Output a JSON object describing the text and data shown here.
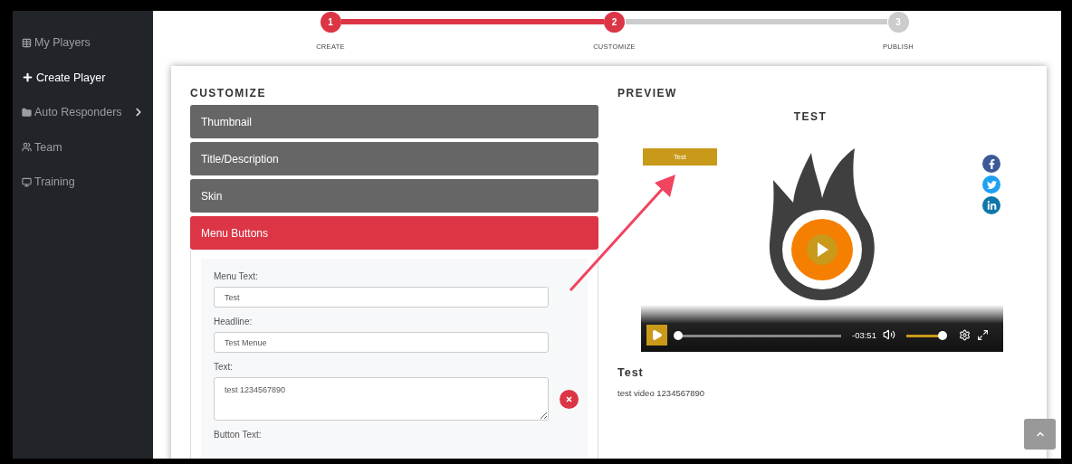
{
  "sidebar": {
    "items": [
      {
        "label": "My Players",
        "selected": false,
        "submenu": false
      },
      {
        "label": "Create Player",
        "selected": true,
        "submenu": false
      },
      {
        "label": "Auto Responders",
        "selected": false,
        "submenu": true
      },
      {
        "label": "Team",
        "selected": false,
        "submenu": false
      },
      {
        "label": "Training",
        "selected": false,
        "submenu": false
      }
    ]
  },
  "stepper": {
    "steps": [
      {
        "number": "1",
        "label": "CREATE",
        "reached": true
      },
      {
        "number": "2",
        "label": "CUSTOMIZE",
        "reached": true
      },
      {
        "number": "3",
        "label": "PUBLISH",
        "reached": false
      }
    ]
  },
  "customize": {
    "title": "CUSTOMIZE",
    "sections": [
      {
        "label": "Thumbnail",
        "expanded": false
      },
      {
        "label": "Title/Description",
        "expanded": false
      },
      {
        "label": "Skin",
        "expanded": false
      },
      {
        "label": "Menu Buttons",
        "expanded": true
      }
    ],
    "fields": [
      {
        "kind": "input",
        "label": "Menu Text:",
        "value": "Test"
      },
      {
        "kind": "input",
        "label": "Headline:",
        "value": "Test Menue"
      },
      {
        "kind": "textarea",
        "label": "Text:",
        "value": "test 1234567890",
        "removable": true
      },
      {
        "kind": "label",
        "label": "Button Text:"
      }
    ]
  },
  "preview": {
    "title": "PREVIEW",
    "video_title": "TEST",
    "menu_button": "Test",
    "player": {
      "progress": {
        "level": 0
      },
      "time": "-03:51",
      "volume": {
        "level": 1
      }
    },
    "caption_title": "Test",
    "caption_text": "test video 1234567890"
  }
}
